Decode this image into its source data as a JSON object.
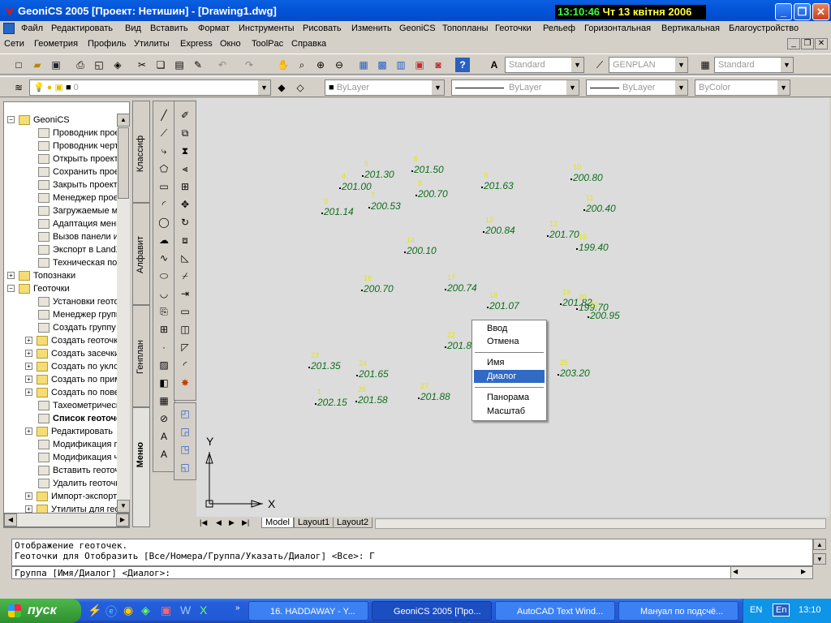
{
  "window": {
    "title": "GeoniCS 2005 [Проект: Нетишин] - [Drawing1.dwg]",
    "clock_time": "13:10:46",
    "clock_date": "Чт 13 квітня 2006",
    "min_glyph": "_",
    "max_glyph": "❐",
    "close_glyph": "✕"
  },
  "menu1": [
    "Файл",
    "Редактировать",
    "Вид",
    "Вставить",
    "Формат",
    "Инструменты",
    "Рисовать",
    "Изменить",
    "GeoniCS",
    "Топопланы",
    "Геоточки",
    "Рельеф",
    "Горизонтальная",
    "Вертикальная",
    "Благоустройство"
  ],
  "menu2": [
    "Сети",
    "Геометрия",
    "Профиль",
    "Утилиты",
    "Express",
    "Окно",
    "ToolPac",
    "Справка"
  ],
  "mdi_buttons": {
    "min": "_",
    "restore": "❐",
    "close": "✕"
  },
  "toolbar": {
    "text_style": "Standard",
    "dim_style": "GENPLAN",
    "table_style": "Standard",
    "layer": "0",
    "color": "ByLayer",
    "linetype": "ByLayer",
    "lineweight": "ByLayer",
    "plotstyle": "ByColor"
  },
  "tree": [
    {
      "label": "GeoniCS",
      "level": 0,
      "expander": "−",
      "kind": "folder"
    },
    {
      "label": "Проводник проектов",
      "level": 1,
      "kind": "item"
    },
    {
      "label": "Проводник чертежа",
      "level": 1,
      "kind": "item"
    },
    {
      "label": "Открыть проект",
      "level": 1,
      "kind": "item"
    },
    {
      "label": "Сохранить проект",
      "level": 1,
      "kind": "item"
    },
    {
      "label": "Закрыть проект",
      "level": 1,
      "kind": "item"
    },
    {
      "label": "Менеджер проектов",
      "level": 1,
      "kind": "item"
    },
    {
      "label": "Загружаемые модули",
      "level": 1,
      "kind": "item"
    },
    {
      "label": "Адаптация меню",
      "level": 1,
      "kind": "item"
    },
    {
      "label": "Вызов панели инструментов",
      "level": 1,
      "kind": "item"
    },
    {
      "label": "Экспорт в LandXML",
      "level": 1,
      "kind": "item"
    },
    {
      "label": "Техническая поддержка",
      "level": 1,
      "kind": "item"
    },
    {
      "label": "Топознаки",
      "level": 0,
      "expander": "+",
      "kind": "folder"
    },
    {
      "label": "Геоточки",
      "level": 0,
      "expander": "−",
      "kind": "folder"
    },
    {
      "label": "Установки геоточек",
      "level": 1,
      "kind": "item"
    },
    {
      "label": "Менеджер групп",
      "level": 1,
      "kind": "item"
    },
    {
      "label": "Создать группу",
      "level": 1,
      "kind": "item"
    },
    {
      "label": "Создать геоточки",
      "level": 1,
      "expander": "+",
      "kind": "folder"
    },
    {
      "label": "Создать засечки",
      "level": 1,
      "expander": "+",
      "kind": "folder"
    },
    {
      "label": "Создать по уклону",
      "level": 1,
      "expander": "+",
      "kind": "folder"
    },
    {
      "label": "Создать по примитивам",
      "level": 1,
      "expander": "+",
      "kind": "folder"
    },
    {
      "label": "Создать по поверхности",
      "level": 1,
      "expander": "+",
      "kind": "folder"
    },
    {
      "label": "Тахеометрический ход",
      "level": 1,
      "kind": "item"
    },
    {
      "label": "Список геоточек",
      "level": 1,
      "kind": "item",
      "bold": true
    },
    {
      "label": "Редактировать",
      "level": 1,
      "expander": "+",
      "kind": "folder"
    },
    {
      "label": "Модификация геоточек",
      "level": 1,
      "kind": "item"
    },
    {
      "label": "Модификация чертежа",
      "level": 1,
      "kind": "item"
    },
    {
      "label": "Вставить геоточки",
      "level": 1,
      "kind": "item"
    },
    {
      "label": "Удалить геоточки",
      "level": 1,
      "kind": "item"
    },
    {
      "label": "Импорт-экспорт",
      "level": 1,
      "expander": "+",
      "kind": "folder"
    },
    {
      "label": "Утилиты для геоточек",
      "level": 1,
      "expander": "+",
      "kind": "folder"
    }
  ],
  "side_tabs": [
    "Классиф",
    "Алфавит",
    "Генплан",
    "Меню"
  ],
  "points": [
    {
      "num": "5",
      "elev": "201.30"
    },
    {
      "num": "6",
      "elev": "201.50"
    },
    {
      "num": "4",
      "elev": "201.00"
    },
    {
      "num": "8",
      "elev": "200.70"
    },
    {
      "num": "9",
      "elev": "201.63"
    },
    {
      "num": "10",
      "elev": "200.80"
    },
    {
      "num": "3",
      "elev": "201.14"
    },
    {
      "num": "7",
      "elev": "200.53"
    },
    {
      "num": "11",
      "elev": "200.40"
    },
    {
      "num": "12",
      "elev": "200.84"
    },
    {
      "num": "13",
      "elev": "201.70"
    },
    {
      "num": "14",
      "elev": "200.10"
    },
    {
      "num": "15",
      "elev": "199.40"
    },
    {
      "num": "16",
      "elev": "200.70"
    },
    {
      "num": "17",
      "elev": "200.74"
    },
    {
      "num": "18",
      "elev": "201.07"
    },
    {
      "num": "19",
      "elev": "201.82"
    },
    {
      "num": "20",
      "elev": "199.70"
    },
    {
      "num": "21",
      "elev": "200.95"
    },
    {
      "num": "22",
      "elev": "201.8"
    },
    {
      "num": "23",
      "elev": "201.35"
    },
    {
      "num": "24",
      "elev": "201.65"
    },
    {
      "num": "25",
      "elev": "203.20"
    },
    {
      "num": "1",
      "elev": "202.15"
    },
    {
      "num": "26",
      "elev": "201.58"
    },
    {
      "num": "27",
      "elev": "201.88"
    }
  ],
  "ucs": {
    "x": "X",
    "y": "Y"
  },
  "context_menu": {
    "items": [
      {
        "label": "Ввод"
      },
      {
        "label": "Отмена"
      },
      {
        "sep": true
      },
      {
        "label": "Имя"
      },
      {
        "label": "Диалог",
        "selected": true
      },
      {
        "sep": true
      },
      {
        "label": "Панорама"
      },
      {
        "label": "Масштаб"
      }
    ]
  },
  "layout_tabs": [
    "Model",
    "Layout1",
    "Layout2"
  ],
  "command": {
    "line1": "Отображение геоточек.",
    "line2": "Геоточки для Отобразить [Все/Номера/Группа/Указать/Диалог] <Все>:  Г",
    "line3": "Группа [Имя/Диалог] <Диалог>:"
  },
  "taskbar": {
    "start": "пуск",
    "tasks": [
      "16. HADDAWAY - Y...",
      "GeoniCS 2005 [Про...",
      "AutoCAD Text Wind...",
      "Мануал по подсчё..."
    ],
    "lang1": "EN",
    "lang2": "En",
    "time": "13:10"
  },
  "colors": {
    "accent": "#316ac5",
    "point_text": "#0e6e1a",
    "point_number": "#e6e600",
    "canvas": "#dcdcdc"
  }
}
